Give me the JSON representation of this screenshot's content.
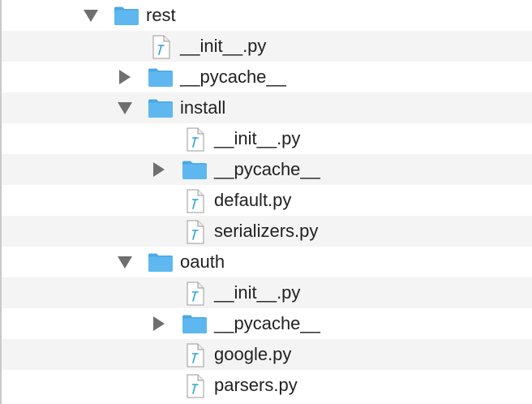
{
  "colors": {
    "folder": "#5eb8ef",
    "folder_tab": "#4aa8e4",
    "file_accent": "#2ba3d8",
    "triangle": "#6f6f6f",
    "text": "#222222",
    "stripe": "#f4f4f4"
  },
  "tree": [
    {
      "name": "rest",
      "type": "folder",
      "depth": 0,
      "expanded": true
    },
    {
      "name": "__init__.py",
      "type": "file",
      "depth": 1
    },
    {
      "name": "__pycache__",
      "type": "folder",
      "depth": 1,
      "expanded": false
    },
    {
      "name": "install",
      "type": "folder",
      "depth": 1,
      "expanded": true
    },
    {
      "name": "__init__.py",
      "type": "file",
      "depth": 2
    },
    {
      "name": "__pycache__",
      "type": "folder",
      "depth": 2,
      "expanded": false
    },
    {
      "name": "default.py",
      "type": "file",
      "depth": 2
    },
    {
      "name": "serializers.py",
      "type": "file",
      "depth": 2
    },
    {
      "name": "oauth",
      "type": "folder",
      "depth": 1,
      "expanded": true
    },
    {
      "name": "__init__.py",
      "type": "file",
      "depth": 2
    },
    {
      "name": "__pycache__",
      "type": "folder",
      "depth": 2,
      "expanded": false
    },
    {
      "name": "google.py",
      "type": "file",
      "depth": 2
    },
    {
      "name": "parsers.py",
      "type": "file",
      "depth": 2
    }
  ]
}
